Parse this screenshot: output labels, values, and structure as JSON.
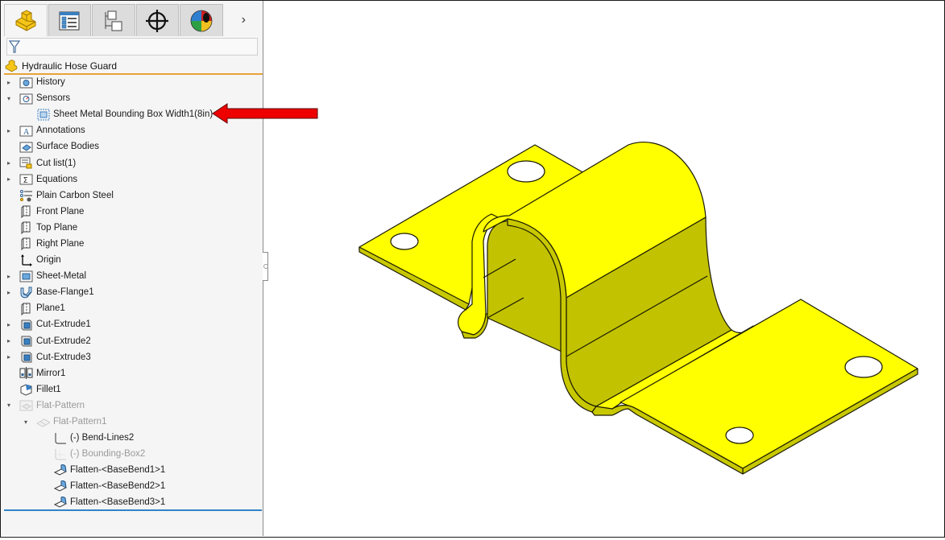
{
  "panel": {
    "tabs": [
      {
        "name": "feature-manager-tab",
        "icon": "part-icon",
        "active": true
      },
      {
        "name": "property-manager-tab",
        "icon": "property-list-icon",
        "active": false
      },
      {
        "name": "configuration-manager-tab",
        "icon": "configuration-tree-icon",
        "active": false
      },
      {
        "name": "dimxpert-manager-tab",
        "icon": "crosshair-icon",
        "active": false
      },
      {
        "name": "display-manager-tab",
        "icon": "appearance-sphere-icon",
        "active": false
      }
    ],
    "more_tabs": "›",
    "filter_placeholder": ""
  },
  "tree": {
    "root": "Hydraulic Hose Guard",
    "items": [
      {
        "label": "History",
        "icon": "history-folder-icon",
        "expander": "collapsed",
        "level": 0
      },
      {
        "label": "Sensors",
        "icon": "sensors-folder-icon",
        "expander": "expanded",
        "level": 0
      },
      {
        "label": "Sheet Metal Bounding Box Width1(8in)",
        "icon": "bounding-box-sensor-icon",
        "expander": "none",
        "level": 1
      },
      {
        "label": "Annotations",
        "icon": "annotations-folder-icon",
        "expander": "collapsed",
        "level": 0
      },
      {
        "label": "Surface Bodies",
        "icon": "surface-bodies-folder-icon",
        "expander": "none",
        "level": 0
      },
      {
        "label": "Cut list(1)",
        "icon": "cut-list-icon",
        "expander": "collapsed",
        "level": 0
      },
      {
        "label": "Equations",
        "icon": "equations-folder-icon",
        "expander": "collapsed",
        "level": 0
      },
      {
        "label": "Plain Carbon Steel",
        "icon": "material-icon",
        "expander": "none",
        "level": 0
      },
      {
        "label": "Front Plane",
        "icon": "plane-icon",
        "expander": "none",
        "level": 0
      },
      {
        "label": "Top Plane",
        "icon": "plane-icon",
        "expander": "none",
        "level": 0
      },
      {
        "label": "Right Plane",
        "icon": "plane-icon",
        "expander": "none",
        "level": 0
      },
      {
        "label": "Origin",
        "icon": "origin-icon",
        "expander": "none",
        "level": 0
      },
      {
        "label": "Sheet-Metal",
        "icon": "sheet-metal-icon",
        "expander": "collapsed",
        "level": 0
      },
      {
        "label": "Base-Flange1",
        "icon": "base-flange-icon",
        "expander": "collapsed",
        "level": 0
      },
      {
        "label": "Plane1",
        "icon": "plane-icon",
        "expander": "none",
        "level": 0
      },
      {
        "label": "Cut-Extrude1",
        "icon": "cut-extrude-icon",
        "expander": "collapsed",
        "level": 0
      },
      {
        "label": "Cut-Extrude2",
        "icon": "cut-extrude-icon",
        "expander": "collapsed",
        "level": 0
      },
      {
        "label": "Cut-Extrude3",
        "icon": "cut-extrude-icon",
        "expander": "collapsed",
        "level": 0
      },
      {
        "label": "Mirror1",
        "icon": "mirror-icon",
        "expander": "none",
        "level": 0
      },
      {
        "label": "Fillet1",
        "icon": "fillet-icon",
        "expander": "none",
        "level": 0
      },
      {
        "label": "Flat-Pattern",
        "icon": "flat-pattern-folder-icon",
        "expander": "expanded",
        "level": 0,
        "suppressed": true
      },
      {
        "label": "Flat-Pattern1",
        "icon": "flat-pattern-icon",
        "expander": "expanded",
        "level": 1,
        "suppressed": true
      },
      {
        "label": "(-) Bend-Lines2",
        "icon": "sketch-icon",
        "expander": "none",
        "level": 2
      },
      {
        "label": "(-) Bounding-Box2",
        "icon": "bounding-box-sketch-icon",
        "expander": "none",
        "level": 2,
        "suppressed": true
      },
      {
        "label": "Flatten-<BaseBend1>1",
        "icon": "flatten-bend-icon",
        "expander": "none",
        "level": 2
      },
      {
        "label": "Flatten-<BaseBend2>1",
        "icon": "flatten-bend-icon",
        "expander": "none",
        "level": 2
      },
      {
        "label": "Flatten-<BaseBend3>1",
        "icon": "flatten-bend-icon",
        "expander": "none",
        "level": 2
      }
    ]
  },
  "annotation": {
    "arrow_color": "#ee0000",
    "points_to": "Sheet Metal Bounding Box Width1(8in)"
  },
  "model": {
    "name": "Hydraulic Hose Guard",
    "color": "#ffff00",
    "shade_color": "#c2c200"
  }
}
